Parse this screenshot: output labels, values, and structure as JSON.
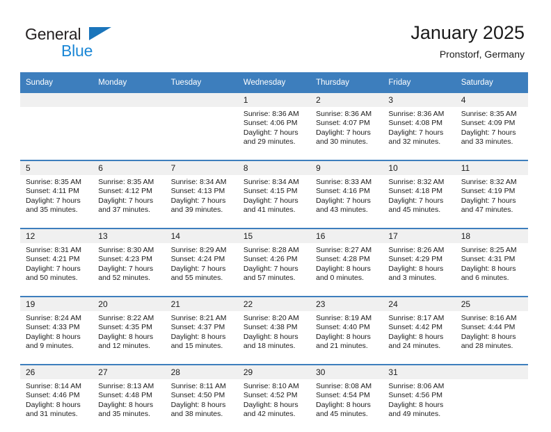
{
  "brand": {
    "word_dark": "General",
    "word_blue": "Blue",
    "triangle_color": "#1b75bb",
    "blue_text_color": "#1b87d6"
  },
  "header": {
    "title": "January 2025",
    "subtitle": "Pronstorf, Germany",
    "header_bg": "#3d7ebd",
    "date_band_bg": "#f0f0f0"
  },
  "weekday_headers": [
    "Sunday",
    "Monday",
    "Tuesday",
    "Wednesday",
    "Thursday",
    "Friday",
    "Saturday"
  ],
  "weeks": [
    [
      {
        "day": "",
        "lines": []
      },
      {
        "day": "",
        "lines": []
      },
      {
        "day": "",
        "lines": []
      },
      {
        "day": "1",
        "lines": [
          "Sunrise: 8:36 AM",
          "Sunset: 4:06 PM",
          "Daylight: 7 hours",
          "and 29 minutes."
        ]
      },
      {
        "day": "2",
        "lines": [
          "Sunrise: 8:36 AM",
          "Sunset: 4:07 PM",
          "Daylight: 7 hours",
          "and 30 minutes."
        ]
      },
      {
        "day": "3",
        "lines": [
          "Sunrise: 8:36 AM",
          "Sunset: 4:08 PM",
          "Daylight: 7 hours",
          "and 32 minutes."
        ]
      },
      {
        "day": "4",
        "lines": [
          "Sunrise: 8:35 AM",
          "Sunset: 4:09 PM",
          "Daylight: 7 hours",
          "and 33 minutes."
        ]
      }
    ],
    [
      {
        "day": "5",
        "lines": [
          "Sunrise: 8:35 AM",
          "Sunset: 4:11 PM",
          "Daylight: 7 hours",
          "and 35 minutes."
        ]
      },
      {
        "day": "6",
        "lines": [
          "Sunrise: 8:35 AM",
          "Sunset: 4:12 PM",
          "Daylight: 7 hours",
          "and 37 minutes."
        ]
      },
      {
        "day": "7",
        "lines": [
          "Sunrise: 8:34 AM",
          "Sunset: 4:13 PM",
          "Daylight: 7 hours",
          "and 39 minutes."
        ]
      },
      {
        "day": "8",
        "lines": [
          "Sunrise: 8:34 AM",
          "Sunset: 4:15 PM",
          "Daylight: 7 hours",
          "and 41 minutes."
        ]
      },
      {
        "day": "9",
        "lines": [
          "Sunrise: 8:33 AM",
          "Sunset: 4:16 PM",
          "Daylight: 7 hours",
          "and 43 minutes."
        ]
      },
      {
        "day": "10",
        "lines": [
          "Sunrise: 8:32 AM",
          "Sunset: 4:18 PM",
          "Daylight: 7 hours",
          "and 45 minutes."
        ]
      },
      {
        "day": "11",
        "lines": [
          "Sunrise: 8:32 AM",
          "Sunset: 4:19 PM",
          "Daylight: 7 hours",
          "and 47 minutes."
        ]
      }
    ],
    [
      {
        "day": "12",
        "lines": [
          "Sunrise: 8:31 AM",
          "Sunset: 4:21 PM",
          "Daylight: 7 hours",
          "and 50 minutes."
        ]
      },
      {
        "day": "13",
        "lines": [
          "Sunrise: 8:30 AM",
          "Sunset: 4:23 PM",
          "Daylight: 7 hours",
          "and 52 minutes."
        ]
      },
      {
        "day": "14",
        "lines": [
          "Sunrise: 8:29 AM",
          "Sunset: 4:24 PM",
          "Daylight: 7 hours",
          "and 55 minutes."
        ]
      },
      {
        "day": "15",
        "lines": [
          "Sunrise: 8:28 AM",
          "Sunset: 4:26 PM",
          "Daylight: 7 hours",
          "and 57 minutes."
        ]
      },
      {
        "day": "16",
        "lines": [
          "Sunrise: 8:27 AM",
          "Sunset: 4:28 PM",
          "Daylight: 8 hours",
          "and 0 minutes."
        ]
      },
      {
        "day": "17",
        "lines": [
          "Sunrise: 8:26 AM",
          "Sunset: 4:29 PM",
          "Daylight: 8 hours",
          "and 3 minutes."
        ]
      },
      {
        "day": "18",
        "lines": [
          "Sunrise: 8:25 AM",
          "Sunset: 4:31 PM",
          "Daylight: 8 hours",
          "and 6 minutes."
        ]
      }
    ],
    [
      {
        "day": "19",
        "lines": [
          "Sunrise: 8:24 AM",
          "Sunset: 4:33 PM",
          "Daylight: 8 hours",
          "and 9 minutes."
        ]
      },
      {
        "day": "20",
        "lines": [
          "Sunrise: 8:22 AM",
          "Sunset: 4:35 PM",
          "Daylight: 8 hours",
          "and 12 minutes."
        ]
      },
      {
        "day": "21",
        "lines": [
          "Sunrise: 8:21 AM",
          "Sunset: 4:37 PM",
          "Daylight: 8 hours",
          "and 15 minutes."
        ]
      },
      {
        "day": "22",
        "lines": [
          "Sunrise: 8:20 AM",
          "Sunset: 4:38 PM",
          "Daylight: 8 hours",
          "and 18 minutes."
        ]
      },
      {
        "day": "23",
        "lines": [
          "Sunrise: 8:19 AM",
          "Sunset: 4:40 PM",
          "Daylight: 8 hours",
          "and 21 minutes."
        ]
      },
      {
        "day": "24",
        "lines": [
          "Sunrise: 8:17 AM",
          "Sunset: 4:42 PM",
          "Daylight: 8 hours",
          "and 24 minutes."
        ]
      },
      {
        "day": "25",
        "lines": [
          "Sunrise: 8:16 AM",
          "Sunset: 4:44 PM",
          "Daylight: 8 hours",
          "and 28 minutes."
        ]
      }
    ],
    [
      {
        "day": "26",
        "lines": [
          "Sunrise: 8:14 AM",
          "Sunset: 4:46 PM",
          "Daylight: 8 hours",
          "and 31 minutes."
        ]
      },
      {
        "day": "27",
        "lines": [
          "Sunrise: 8:13 AM",
          "Sunset: 4:48 PM",
          "Daylight: 8 hours",
          "and 35 minutes."
        ]
      },
      {
        "day": "28",
        "lines": [
          "Sunrise: 8:11 AM",
          "Sunset: 4:50 PM",
          "Daylight: 8 hours",
          "and 38 minutes."
        ]
      },
      {
        "day": "29",
        "lines": [
          "Sunrise: 8:10 AM",
          "Sunset: 4:52 PM",
          "Daylight: 8 hours",
          "and 42 minutes."
        ]
      },
      {
        "day": "30",
        "lines": [
          "Sunrise: 8:08 AM",
          "Sunset: 4:54 PM",
          "Daylight: 8 hours",
          "and 45 minutes."
        ]
      },
      {
        "day": "31",
        "lines": [
          "Sunrise: 8:06 AM",
          "Sunset: 4:56 PM",
          "Daylight: 8 hours",
          "and 49 minutes."
        ]
      },
      {
        "day": "",
        "lines": []
      }
    ]
  ]
}
